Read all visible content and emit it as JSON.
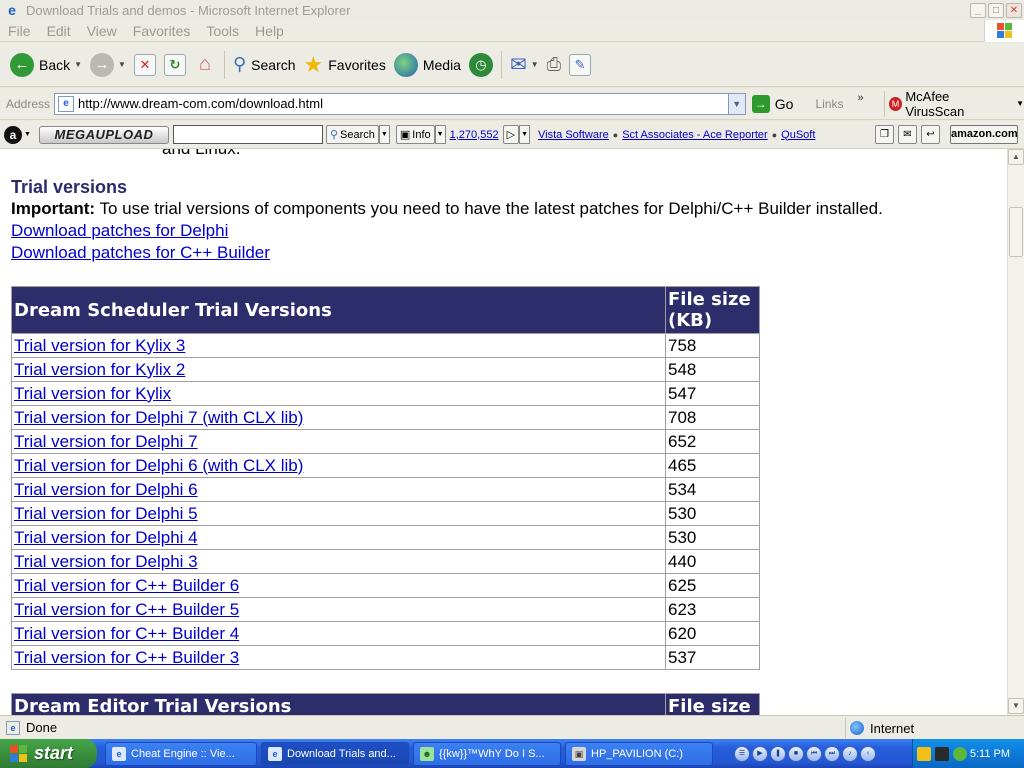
{
  "window": {
    "title": "Download Trials and demos - Microsoft Internet Explorer",
    "buttons": {
      "minimize": "_",
      "maximize": "□",
      "close": "✕"
    }
  },
  "menu": [
    "File",
    "Edit",
    "View",
    "Favorites",
    "Tools",
    "Help"
  ],
  "toolbar": {
    "back": "Back",
    "search": "Search",
    "favorites": "Favorites",
    "media": "Media"
  },
  "address": {
    "label": "Address",
    "url": "http://www.dream-com.com/download.html",
    "go": "Go",
    "links": "Links",
    "mcafee": "McAfee VirusScan"
  },
  "megabar": {
    "logo": "MEGAUPLOAD",
    "search": "Search",
    "info": "Info",
    "count": "1,270,552",
    "links": [
      "Vista Software",
      "Sct Associates - Ace Reporter",
      "QuSoft"
    ],
    "amazon": "amazon.com"
  },
  "page": {
    "cut_text": "and Linux.",
    "heading": "Trial versions",
    "important_label": "Important:",
    "important_text": " To use trial versions of components you need to have the latest patches for Delphi/C++ Builder installed.",
    "link_delphi": "Download patches for Delphi",
    "link_cbuilder": "Download patches for C++ Builder",
    "table1": {
      "header_name": "Dream Scheduler Trial Versions",
      "header_size": "File size (KB)",
      "rows": [
        {
          "name": "Trial version for Kylix 3",
          "size": "758"
        },
        {
          "name": "Trial version for Kylix 2",
          "size": "548"
        },
        {
          "name": "Trial version for Kylix",
          "size": "547"
        },
        {
          "name": "Trial version for Delphi 7 (with CLX lib)",
          "size": "708"
        },
        {
          "name": "Trial version for Delphi 7",
          "size": "652"
        },
        {
          "name": "Trial version for Delphi 6 (with CLX lib)",
          "size": "465"
        },
        {
          "name": "Trial version for Delphi 6",
          "size": "534"
        },
        {
          "name": "Trial version for Delphi 5",
          "size": "530"
        },
        {
          "name": "Trial version for Delphi 4",
          "size": "530"
        },
        {
          "name": "Trial version for Delphi 3",
          "size": "440"
        },
        {
          "name": "Trial version for C++ Builder 6",
          "size": "625"
        },
        {
          "name": "Trial version for C++ Builder 5",
          "size": "623"
        },
        {
          "name": "Trial version for C++ Builder 4",
          "size": "620"
        },
        {
          "name": "Trial version for C++ Builder 3",
          "size": "537"
        }
      ]
    },
    "table2": {
      "header_name": "Dream Editor Trial Versions",
      "header_size": "File size"
    }
  },
  "status": {
    "text": "Done",
    "zone": "Internet"
  },
  "taskbar": {
    "start": "start",
    "tasks": [
      "Cheat Engine :: Vie...",
      "Download Trials and...",
      "{{kw}}™WhY Do I S...",
      "HP_PAVILION (C:)"
    ],
    "clock": "5:11 PM"
  }
}
